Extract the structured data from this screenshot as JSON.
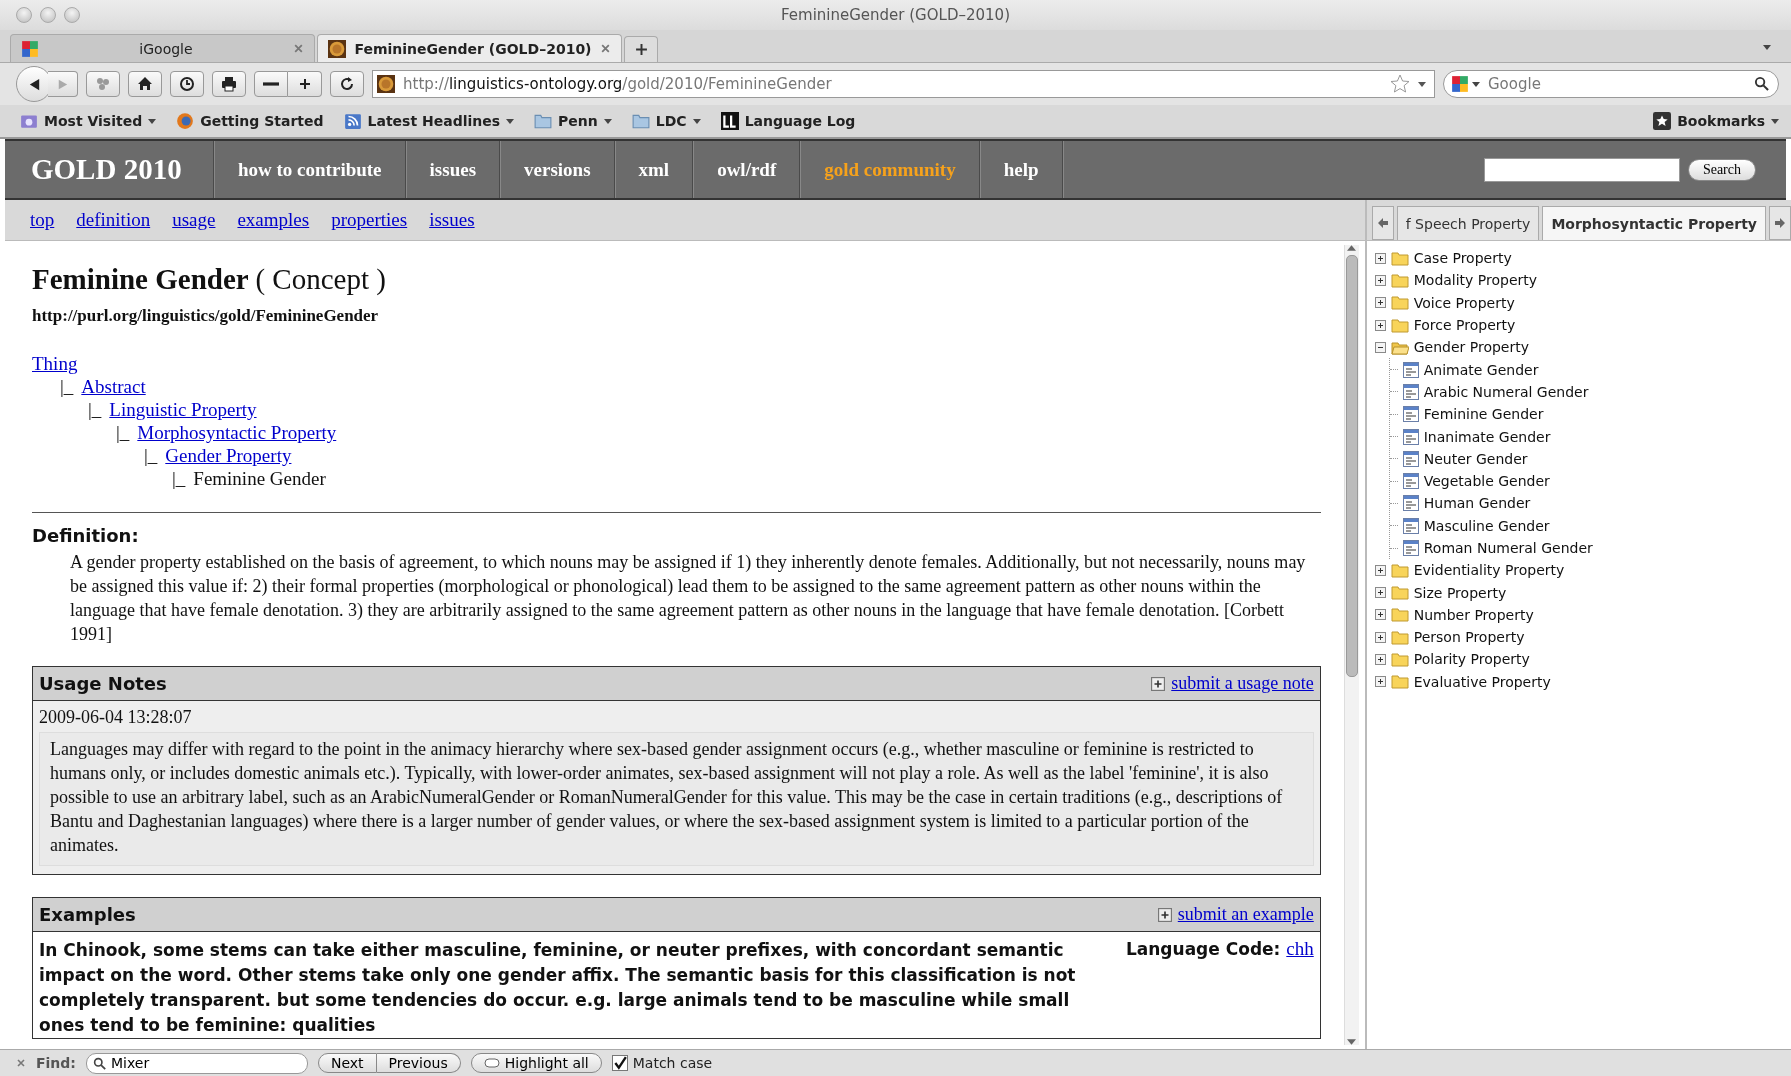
{
  "window": {
    "title": "FeminineGender (GOLD–2010)"
  },
  "tabs": [
    {
      "label": "iGoogle",
      "selected": false
    },
    {
      "label": "FeminineGender (GOLD–2010)",
      "selected": true
    }
  ],
  "address_bar": {
    "scheme": "http://",
    "host": "linguistics-ontology.org",
    "path": "/gold/2010/FeminineGender"
  },
  "search_field": {
    "placeholder": "Google"
  },
  "bookmarks": [
    {
      "label": "Most Visited",
      "kind": "smart",
      "dropdown": true
    },
    {
      "label": "Getting Started",
      "kind": "fox",
      "dropdown": false
    },
    {
      "label": "Latest Headlines",
      "kind": "feed",
      "dropdown": true
    },
    {
      "label": "Penn",
      "kind": "folder",
      "dropdown": true
    },
    {
      "label": "LDC",
      "kind": "folder",
      "dropdown": true
    },
    {
      "label": "Language Log",
      "kind": "badge",
      "dropdown": false
    }
  ],
  "bookmarks_menu": {
    "label": "Bookmarks"
  },
  "site": {
    "brand": "GOLD 2010",
    "nav": [
      {
        "label": "how to contribute",
        "highlighted": false
      },
      {
        "label": "issues",
        "highlighted": false
      },
      {
        "label": "versions",
        "highlighted": false
      },
      {
        "label": "xml",
        "highlighted": false
      },
      {
        "label": "owl/rdf",
        "highlighted": false
      },
      {
        "label": "gold community",
        "highlighted": true
      },
      {
        "label": "help",
        "highlighted": false
      }
    ],
    "search_button": "Search",
    "subnav": [
      "top",
      "definition",
      "usage",
      "examples",
      "properties",
      "issues"
    ]
  },
  "concept": {
    "title": "Feminine Gender",
    "type": "( Concept )",
    "uri": "http://purl.org/linguistics/gold/FeminineGender",
    "hierarchy": [
      {
        "label": "Thing",
        "link": true,
        "children": [
          {
            "label": "Abstract",
            "link": true,
            "children": [
              {
                "label": "Linguistic Property",
                "link": true,
                "children": [
                  {
                    "label": "Morphosyntactic Property",
                    "link": true,
                    "children": [
                      {
                        "label": "Gender Property",
                        "link": true,
                        "children": [
                          {
                            "label": "Feminine Gender",
                            "link": false
                          }
                        ]
                      }
                    ]
                  }
                ]
              }
            ]
          }
        ]
      }
    ],
    "prefix": "|_"
  },
  "definition": {
    "heading": "Definition:",
    "text": "A gender property established on the basis of agreement, to which nouns may be assigned if 1) they inherently denote females. Additionally, but not necessarily, nouns may be assigned this value if: 2) their formal properties (morphological or phonological) lead them to be assigned to the same agreement pattern as other nouns within the language that have female denotation. 3) they are arbitrarily assigned to the same agreement pattern as other nouns in the language that have female denotation. [Corbett 1991]"
  },
  "usage_notes": {
    "heading": "Usage Notes",
    "action": "submit a usage note",
    "notes": [
      {
        "date": "2009-06-04 13:28:07",
        "text": "Languages may differ with regard to the point in the animacy hierarchy where sex-based gender assignment occurs (e.g., whether masculine or feminine is restricted to humans only, or includes domestic animals etc.). Typically, with lower-order animates, sex-based assignment will not play a role. As well as the label 'feminine', it is also possible to use an arbitrary label, such as an ArabicNumeralGender or RomanNumeralGender for this value. This may be the case in certain traditions (e.g., descriptions of Bantu and Daghestanian languages) where there is a larger number of gender values, or where the sex-based assignment system is limited to a particular portion of the animates."
      }
    ]
  },
  "examples": {
    "heading": "Examples",
    "action": "submit an example",
    "items": [
      {
        "text": "In Chinook, some stems can take either masculine, feminine, or neuter prefixes, with concordant semantic impact on the word. Other stems take only one gender affix. The semantic basis for this classification is not completely transparent. but some tendencies do occur. e.g. large animals tend to be masculine while small ones tend to be feminine: qualities",
        "language_label": "Language Code:",
        "language_code": "chh"
      }
    ]
  },
  "sidebar": {
    "tabs": [
      {
        "label": "f Speech Property",
        "selected": false
      },
      {
        "label": "Morphosyntactic Property",
        "selected": true
      }
    ],
    "tree": [
      {
        "label": "Case Property",
        "kind": "folder",
        "expanded": false
      },
      {
        "label": "Modality Property",
        "kind": "folder",
        "expanded": false
      },
      {
        "label": "Voice Property",
        "kind": "folder",
        "expanded": false
      },
      {
        "label": "Force Property",
        "kind": "folder",
        "expanded": false
      },
      {
        "label": "Gender Property",
        "kind": "folder",
        "expanded": true,
        "children": [
          {
            "label": "Animate Gender",
            "kind": "leaf"
          },
          {
            "label": "Arabic Numeral Gender",
            "kind": "leaf"
          },
          {
            "label": "Feminine Gender",
            "kind": "leaf"
          },
          {
            "label": "Inanimate Gender",
            "kind": "leaf"
          },
          {
            "label": "Neuter Gender",
            "kind": "leaf"
          },
          {
            "label": "Vegetable Gender",
            "kind": "leaf"
          },
          {
            "label": "Human Gender",
            "kind": "leaf"
          },
          {
            "label": "Masculine Gender",
            "kind": "leaf"
          },
          {
            "label": "Roman Numeral Gender",
            "kind": "leaf"
          }
        ]
      },
      {
        "label": "Evidentiality Property",
        "kind": "folder",
        "expanded": false
      },
      {
        "label": "Size Property",
        "kind": "folder",
        "expanded": false
      },
      {
        "label": "Number Property",
        "kind": "folder",
        "expanded": false
      },
      {
        "label": "Person Property",
        "kind": "folder",
        "expanded": false
      },
      {
        "label": "Polarity Property",
        "kind": "folder",
        "expanded": false
      },
      {
        "label": "Evaluative Property",
        "kind": "folder",
        "expanded": false
      }
    ]
  },
  "find_bar": {
    "label": "Find:",
    "value": "Mixer",
    "buttons": [
      "Next",
      "Previous"
    ],
    "highlight_all": "Highlight all",
    "match_case": {
      "label": "Match case",
      "checked": true
    }
  }
}
